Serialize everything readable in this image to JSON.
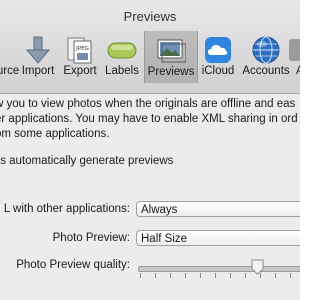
{
  "window": {
    "title": "Previews"
  },
  "toolbar": {
    "items": [
      {
        "label": "Source",
        "icon": "source-icon"
      },
      {
        "label": "Import",
        "icon": "import-arrow-icon"
      },
      {
        "label": "Export",
        "icon": "export-jpeg-icon"
      },
      {
        "label": "Labels",
        "icon": "labels-icon"
      },
      {
        "label": "Previews",
        "icon": "previews-icon",
        "selected": true
      },
      {
        "label": "iCloud",
        "icon": "icloud-icon"
      },
      {
        "label": "Accounts",
        "icon": "accounts-globe-icon"
      },
      {
        "label": "A",
        "icon": "advanced-icon"
      }
    ]
  },
  "content": {
    "description_lines": [
      "w you to view photos when the originals are offline and eas",
      "er applications. You may have to enable XML sharing in ord",
      "om some applications."
    ],
    "auto_previews_label": "ts automatically generate previews",
    "share_label": "L with other applications:",
    "share_value": "Always",
    "photo_preview_label": "Photo Preview:",
    "photo_preview_value": "Half Size",
    "quality_label": "Photo Preview quality:",
    "quality_level": 0.69
  },
  "colors": {
    "selected_tab_bg": "#b7b7b7",
    "labels_green": "#a9c95a",
    "icloud_blue": "#2f86e0"
  }
}
